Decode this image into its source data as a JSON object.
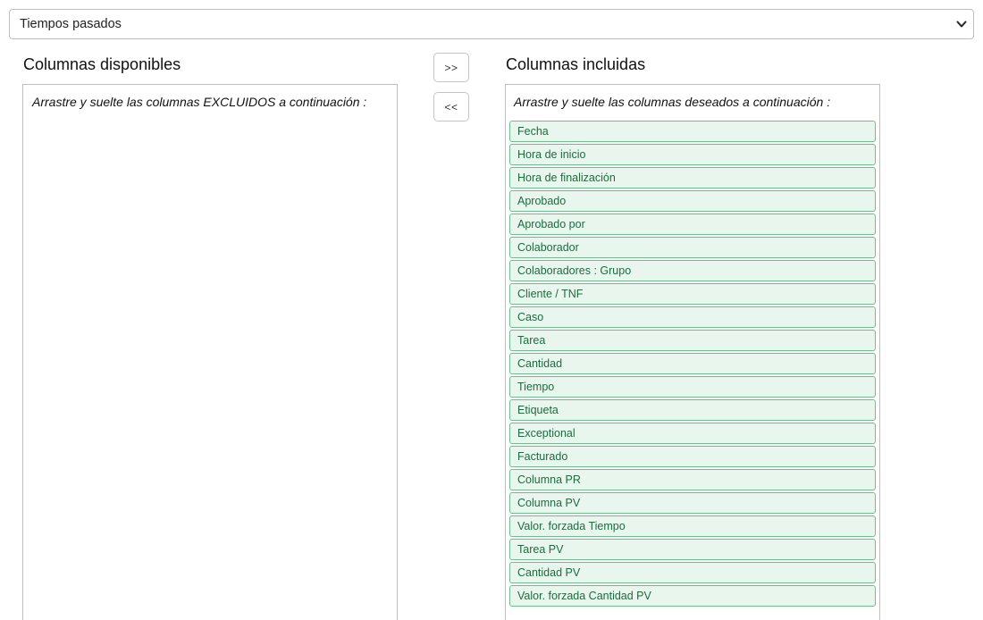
{
  "report_select": {
    "selected": "Tiempos pasados"
  },
  "available": {
    "title": "Columnas disponibles",
    "hint": "Arrastre y suelte las columnas EXCLUIDOS a continuación :"
  },
  "controls": {
    "add_label": ">>",
    "remove_label": "<<"
  },
  "included": {
    "title": "Columnas incluidas",
    "hint": "Arrastre y suelte las columnas deseados a continuación :",
    "items": [
      "Fecha",
      "Hora de inicio",
      "Hora de finalización",
      "Aprobado",
      "Aprobado por",
      "Colaborador",
      "Colaboradores : Grupo",
      "Cliente / TNF",
      "Caso",
      "Tarea",
      "Cantidad",
      "Tiempo",
      "Etiqueta",
      "Exceptional",
      "Facturado",
      "Columna PR",
      "Columna PV",
      "Valor. forzada Tiempo",
      "Tarea PV",
      "Cantidad PV",
      "Valor. forzada Cantidad PV"
    ]
  },
  "colors": {
    "item_border": "#6cbf8a",
    "item_background": "#e9f6ee",
    "item_text": "#1f6a3f"
  }
}
